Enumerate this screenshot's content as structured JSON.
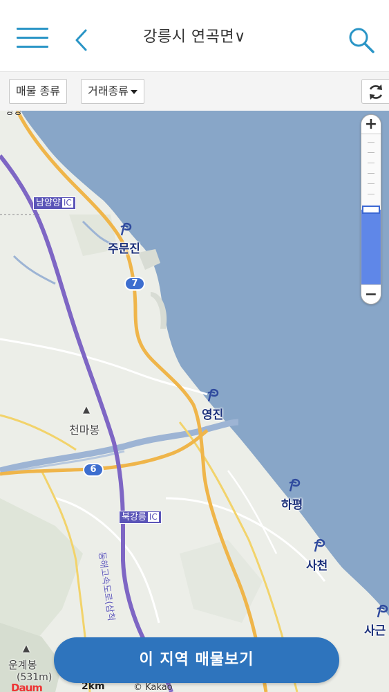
{
  "header": {
    "title": "강릉시 연곡면∨",
    "menu_icon": "hamburger-menu-icon",
    "back_icon": "chevron-left-icon",
    "search_icon": "search-icon",
    "accent_color": "#2a95c6"
  },
  "filters": {
    "property_type_label": "매물 종류",
    "deal_type_label": "거래종류",
    "refresh_icon": "refresh-icon"
  },
  "map": {
    "places": [
      "주문진",
      "영진",
      "하평",
      "사천",
      "사근"
    ],
    "mountains": [
      "천마봉",
      "운계봉",
      "(531m)"
    ],
    "interchanges": [
      "남양양",
      "북강릉"
    ],
    "interchange_badge": "IC",
    "routes": [
      "7",
      "6"
    ],
    "expressway_label": "동해고속도로(삼척",
    "top_label": "양양",
    "sea_color": "#88a6c8",
    "land_color": "#eceee8",
    "expressway_color": "#7e66c4",
    "road_color": "#efb54a"
  },
  "zoom": {
    "in_label": "+",
    "out_label": "−",
    "level_fraction": 0.5
  },
  "cta": {
    "label": "이 지역 매물보기"
  },
  "footer": {
    "scale_label": "2km",
    "copyright": "© Kakao",
    "logo": "Daum"
  }
}
